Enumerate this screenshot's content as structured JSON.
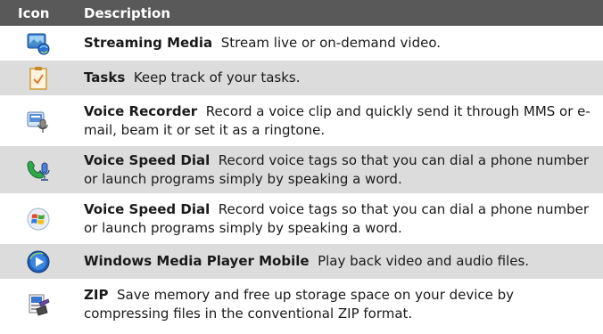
{
  "header": {
    "icon_label": "Icon",
    "description_label": "Description"
  },
  "rows": [
    {
      "icon": "streaming-media-icon",
      "name": "Streaming Media",
      "description": "Stream live or on-demand video."
    },
    {
      "icon": "tasks-icon",
      "name": "Tasks",
      "description": "Keep track of your tasks."
    },
    {
      "icon": "voice-recorder-icon",
      "name": "Voice Recorder",
      "description": "Record a voice clip and quickly send it through MMS or e-mail, beam it or set it as a ringtone."
    },
    {
      "icon": "voice-speed-dial-icon",
      "name": "Voice Speed Dial",
      "description": "Record voice tags so that you can dial a phone number or launch programs simply by speaking a word."
    },
    {
      "icon": "windows-logo-icon",
      "name": "Voice Speed Dial",
      "description": "Record voice tags so that you can dial a phone number or launch programs simply by speaking a word."
    },
    {
      "icon": "windows-media-player-icon",
      "name": "Windows Media Player Mobile",
      "description": "Play back video and audio files."
    },
    {
      "icon": "zip-icon",
      "name": "ZIP",
      "description": "Save memory and free up storage space on your device by compressing files in the conventional ZIP format."
    }
  ]
}
